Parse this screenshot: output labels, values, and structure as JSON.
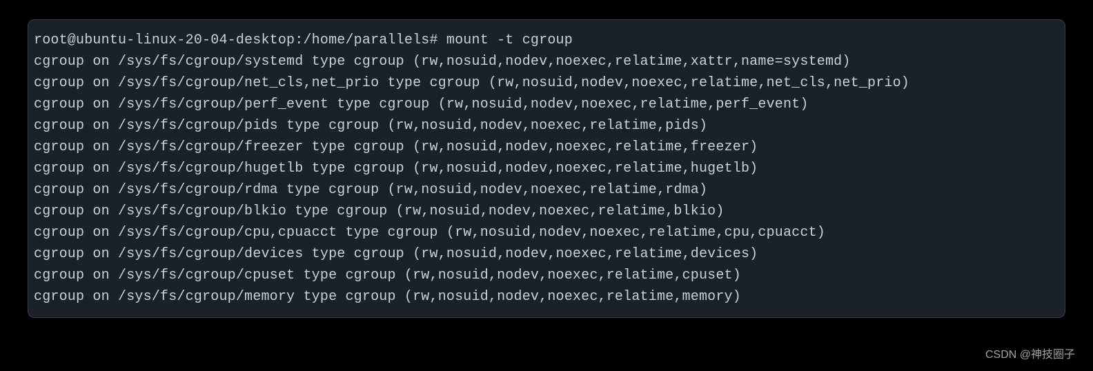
{
  "terminal": {
    "prompt": "root@ubuntu-linux-20-04-desktop:/home/parallels# mount -t cgroup",
    "output": [
      "cgroup on /sys/fs/cgroup/systemd type cgroup (rw,nosuid,nodev,noexec,relatime,xattr,name=systemd)",
      "cgroup on /sys/fs/cgroup/net_cls,net_prio type cgroup (rw,nosuid,nodev,noexec,relatime,net_cls,net_prio)",
      "cgroup on /sys/fs/cgroup/perf_event type cgroup (rw,nosuid,nodev,noexec,relatime,perf_event)",
      "cgroup on /sys/fs/cgroup/pids type cgroup (rw,nosuid,nodev,noexec,relatime,pids)",
      "cgroup on /sys/fs/cgroup/freezer type cgroup (rw,nosuid,nodev,noexec,relatime,freezer)",
      "cgroup on /sys/fs/cgroup/hugetlb type cgroup (rw,nosuid,nodev,noexec,relatime,hugetlb)",
      "cgroup on /sys/fs/cgroup/rdma type cgroup (rw,nosuid,nodev,noexec,relatime,rdma)",
      "cgroup on /sys/fs/cgroup/blkio type cgroup (rw,nosuid,nodev,noexec,relatime,blkio)",
      "cgroup on /sys/fs/cgroup/cpu,cpuacct type cgroup (rw,nosuid,nodev,noexec,relatime,cpu,cpuacct)",
      "cgroup on /sys/fs/cgroup/devices type cgroup (rw,nosuid,nodev,noexec,relatime,devices)",
      "cgroup on /sys/fs/cgroup/cpuset type cgroup (rw,nosuid,nodev,noexec,relatime,cpuset)",
      "cgroup on /sys/fs/cgroup/memory type cgroup (rw,nosuid,nodev,noexec,relatime,memory)"
    ]
  },
  "watermark": "CSDN @神技圈子"
}
